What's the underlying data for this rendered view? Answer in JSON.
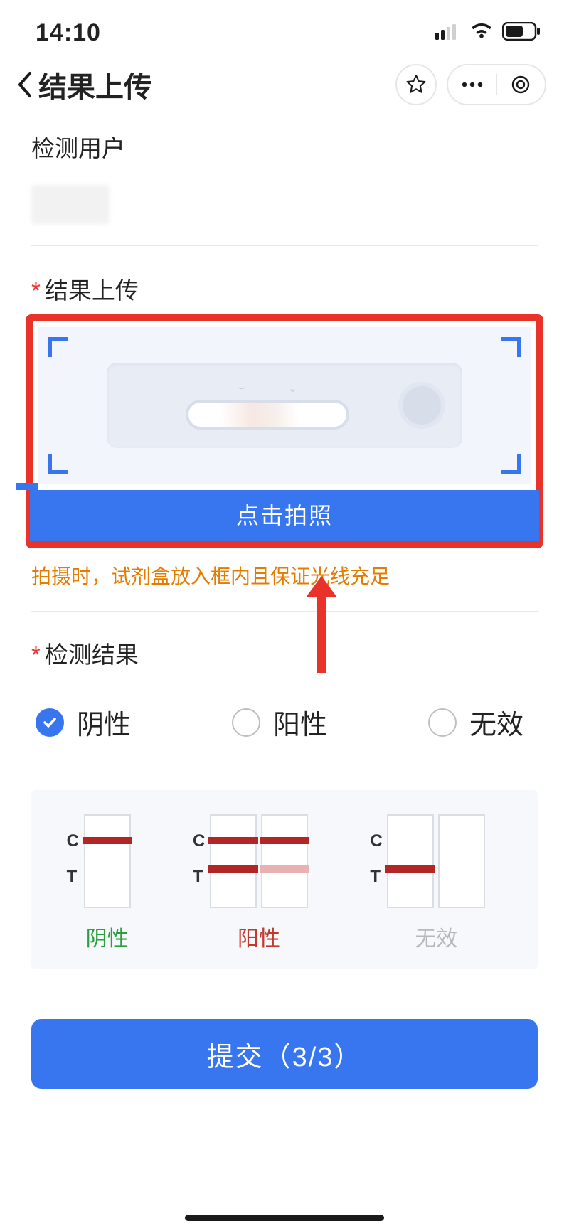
{
  "status": {
    "time": "14:10"
  },
  "header": {
    "title": "结果上传"
  },
  "sections": {
    "user_label": "检测用户",
    "upload_label": "结果上传",
    "photo_button": "点击拍照",
    "photo_hint": "拍摄时，试剂盒放入框内且保证光线充足",
    "result_label": "检测结果"
  },
  "result_options": {
    "negative": "阴性",
    "positive": "阳性",
    "invalid": "无效",
    "selected": "negative"
  },
  "legend": {
    "c": "C",
    "t": "T",
    "negative": "阴性",
    "positive": "阳性",
    "invalid": "无效"
  },
  "submit": {
    "label": "提交（3/3）"
  },
  "colors": {
    "primary": "#3776ef",
    "highlight": "#e8322a",
    "warn": "#e57c00"
  }
}
